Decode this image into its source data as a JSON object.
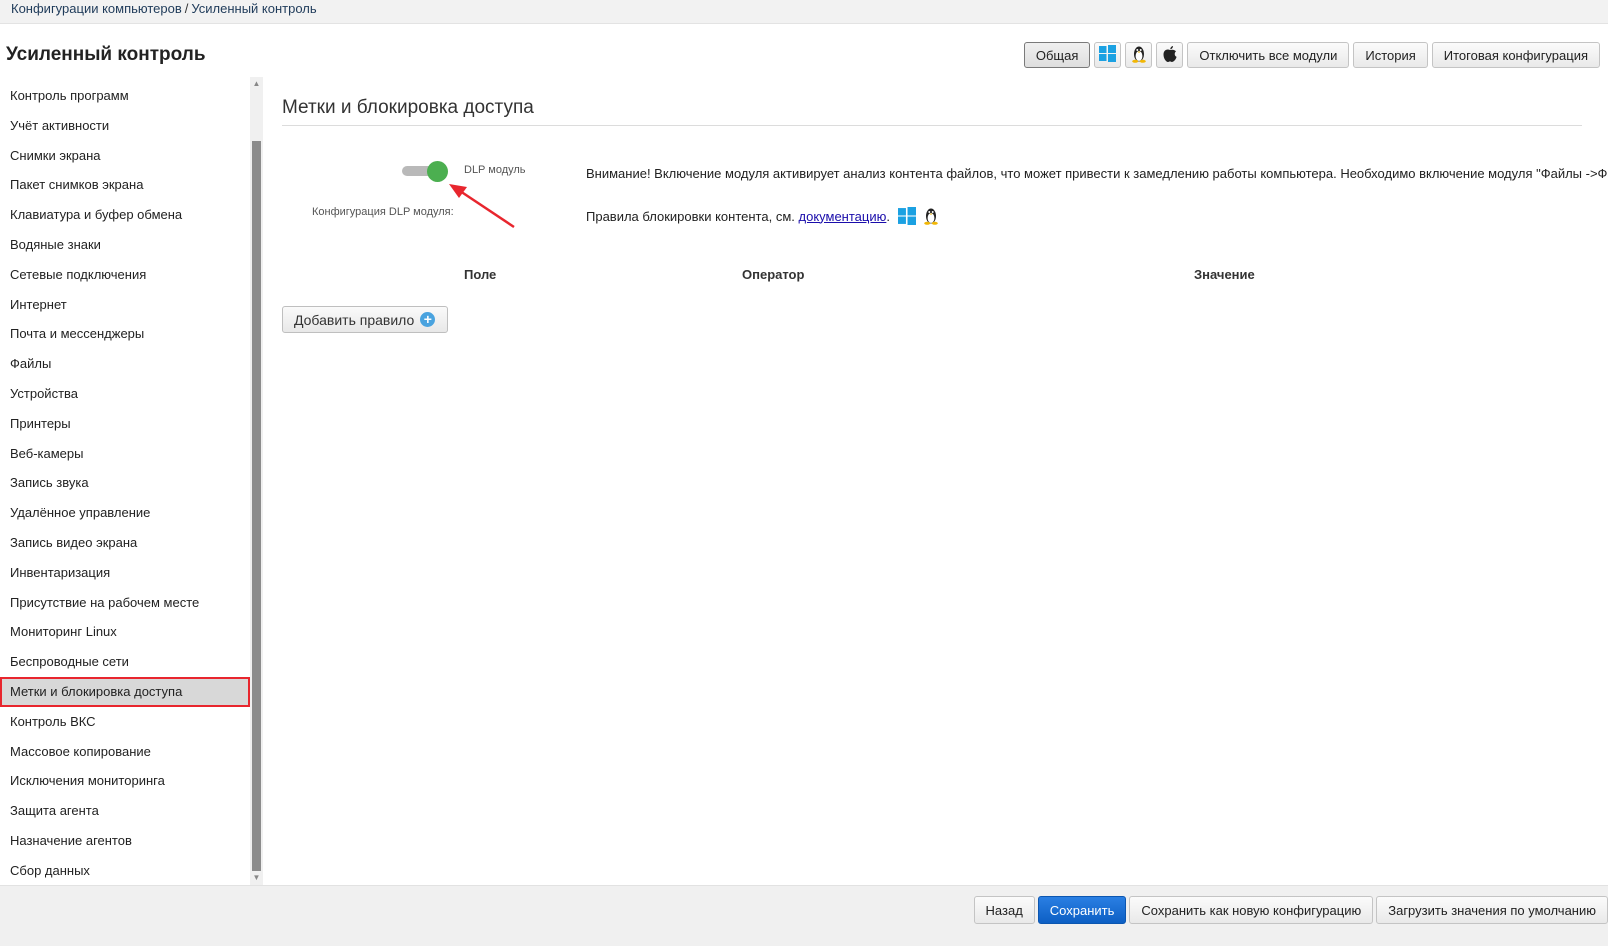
{
  "breadcrumb": {
    "root": "Конфигурации компьютеров",
    "separator": "/",
    "current": "Усиленный контроль"
  },
  "page_title": "Усиленный контроль",
  "toolbar": {
    "general": "Общая",
    "windows_icon": "windows-icon",
    "linux_icon": "linux-icon",
    "apple_icon": "apple-icon",
    "disable_all": "Отключить все модули",
    "history": "История",
    "final_config": "Итоговая конфигурация"
  },
  "sidebar": {
    "items": [
      {
        "label": "Контроль программ"
      },
      {
        "label": "Учёт активности"
      },
      {
        "label": "Снимки экрана"
      },
      {
        "label": "Пакет снимков экрана"
      },
      {
        "label": "Клавиатура и буфер обмена"
      },
      {
        "label": "Водяные знаки"
      },
      {
        "label": "Сетевые подключения"
      },
      {
        "label": "Интернет"
      },
      {
        "label": "Почта и мессенджеры"
      },
      {
        "label": "Файлы"
      },
      {
        "label": "Устройства"
      },
      {
        "label": "Принтеры"
      },
      {
        "label": "Веб-камеры"
      },
      {
        "label": "Запись звука"
      },
      {
        "label": "Удалённое управление"
      },
      {
        "label": "Запись видео экрана"
      },
      {
        "label": "Инвентаризация"
      },
      {
        "label": "Присутствие на рабочем месте"
      },
      {
        "label": "Мониторинг Linux"
      },
      {
        "label": "Беспроводные сети"
      },
      {
        "label": "Метки и блокировка доступа",
        "selected": true
      },
      {
        "label": "Контроль ВКС"
      },
      {
        "label": "Массовое копирование"
      },
      {
        "label": "Исключения мониторинга"
      },
      {
        "label": "Защита агента"
      },
      {
        "label": "Назначение агентов"
      },
      {
        "label": "Сбор данных"
      }
    ]
  },
  "main": {
    "section_title": "Метки и блокировка доступа",
    "dlp_toggle": {
      "label": "DLP модуль",
      "enabled": true,
      "color": "#4caf50"
    },
    "config_label": "Конфигурация DLP модуля:",
    "warning": "Внимание! Включение модуля активирует анализ контента файлов, что может привести к замедлению работы компьютера. Необходимо включение модуля \"Файлы ->Фай",
    "rules_prefix": "Правила блокировки контента, см.",
    "rules_link": "документацию",
    "rules_suffix": ".",
    "table_headers": {
      "field": "Поле",
      "operator": "Оператор",
      "value": "Значение"
    },
    "add_rule": "Добавить правило",
    "annotation_color": "#e8262e"
  },
  "footer": {
    "back": "Назад",
    "save": "Сохранить",
    "save_as_new": "Сохранить как новую конфигурацию",
    "load_defaults": "Загрузить значения по умолчанию"
  }
}
